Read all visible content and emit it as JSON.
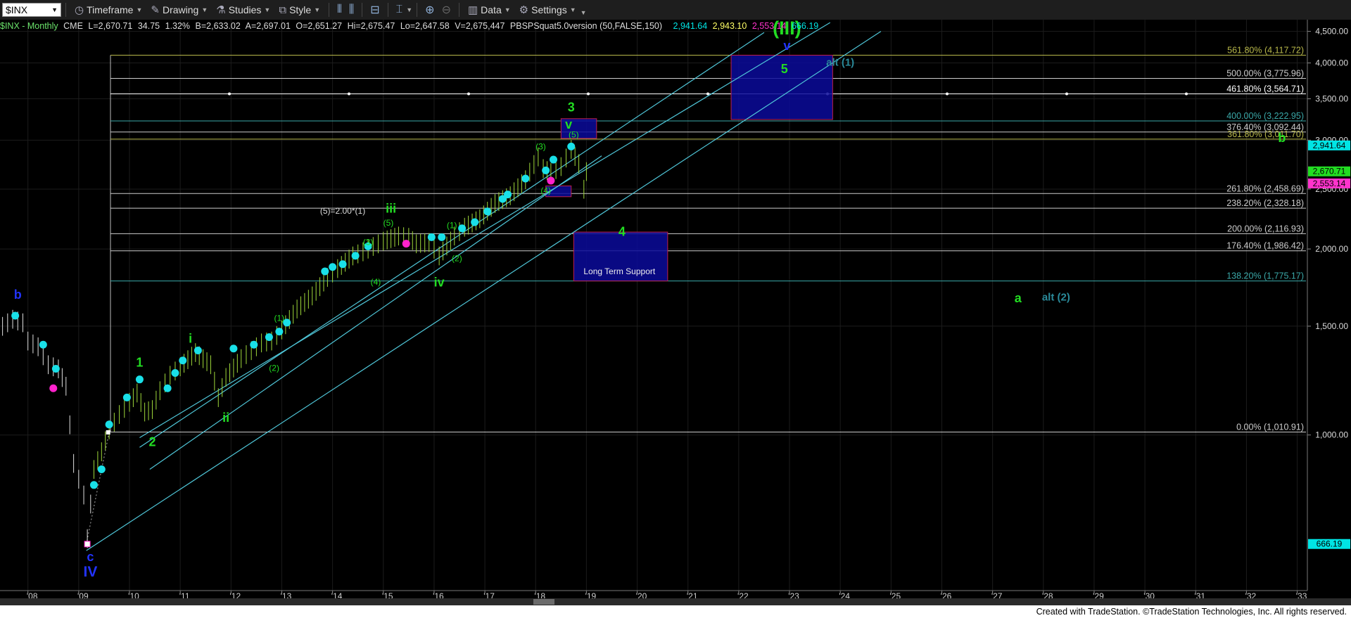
{
  "toolbar": {
    "symbol": "$INX",
    "items": [
      {
        "label": "Timeframe",
        "icon": "clock-icon"
      },
      {
        "label": "Drawing",
        "icon": "pencil-icon"
      },
      {
        "label": "Studies",
        "icon": "flask-icon"
      },
      {
        "label": "Style",
        "icon": "style-icon"
      },
      {
        "label": "Data",
        "icon": "bar-chart-icon"
      },
      {
        "label": "Settings",
        "icon": "gear-icon"
      }
    ]
  },
  "infobar": {
    "symbol_info": "$INX - Monthly",
    "exchange": "CME",
    "last": "L=2,670.71",
    "change": "34.75",
    "pct": "1.32%",
    "bid": "B=2,633.02",
    "ask": "A=2,697.01",
    "open": "O=2,651.27",
    "high": "Hi=2,675.47",
    "low": "Lo=2,647.58",
    "volume": "V=2,675,447",
    "study": "PBSPSquat5.0version (50,FALSE,150)",
    "study_vals": [
      {
        "text": "2,941.64",
        "color": "#00e5e5"
      },
      {
        "text": "2,943.10",
        "color": "#ffff66"
      },
      {
        "text": "2,553.14",
        "color": "#ff33cc"
      },
      {
        "text": "666.19",
        "color": "#00e5e5"
      }
    ]
  },
  "footer": "Created with TradeStation. ©TradeStation Technologies, Inc. All rights reserved.",
  "chart_data": {
    "type": "line",
    "title": "$INX - Monthly",
    "y_scale": "log",
    "ylim": [
      560,
      4700
    ],
    "xlim": [
      2007.45,
      2033.2
    ],
    "y_ticks": [
      {
        "value": 4500,
        "label": "4,500.00"
      },
      {
        "value": 4000,
        "label": "4,000.00"
      },
      {
        "value": 3500,
        "label": "3,500.00"
      },
      {
        "value": 3000,
        "label": "3,000.00"
      },
      {
        "value": 2500,
        "label": "2,500.00"
      },
      {
        "value": 2000,
        "label": "2,000.00"
      },
      {
        "value": 1500,
        "label": "1,500.00"
      },
      {
        "value": 1000,
        "label": "1,000.00"
      }
    ],
    "x_ticks": [
      "'08",
      "'09",
      "'10",
      "'11",
      "'12",
      "'13",
      "'14",
      "'15",
      "'16",
      "'17",
      "'18",
      "'19",
      "'20",
      "'21",
      "'22",
      "'23",
      "'24",
      "'25",
      "'26",
      "'27",
      "'28",
      "'29",
      "'30",
      "'31",
      "'32",
      "'33"
    ],
    "price_series": {
      "name": "$INX Monthly close",
      "x": [
        2007.5,
        2007.7,
        2007.9,
        2008.0,
        2008.2,
        2008.4,
        2008.6,
        2008.75,
        2008.9,
        2009.1,
        2009.17,
        2009.3,
        2009.45,
        2009.6,
        2009.8,
        2010.0,
        2010.15,
        2010.3,
        2010.45,
        2010.6,
        2010.8,
        2011.0,
        2011.3,
        2011.6,
        2011.75,
        2011.9,
        2012.2,
        2012.4,
        2012.6,
        2012.8,
        2013.0,
        2013.3,
        2013.6,
        2013.9,
        2014.1,
        2014.4,
        2014.6,
        2014.8,
        2015.0,
        2015.3,
        2015.5,
        2015.65,
        2015.9,
        2016.1,
        2016.4,
        2016.6,
        2016.9,
        2017.2,
        2017.5,
        2017.8,
        2018.05,
        2018.15,
        2018.3,
        2018.5,
        2018.7,
        2018.85,
        2018.95,
        2019.0
      ],
      "y": [
        1500,
        1540,
        1520,
        1420,
        1390,
        1300,
        1280,
        1200,
        900,
        800,
        680,
        880,
        940,
        1020,
        1080,
        1130,
        1170,
        1090,
        1100,
        1180,
        1250,
        1290,
        1360,
        1300,
        1150,
        1240,
        1330,
        1370,
        1410,
        1420,
        1480,
        1600,
        1680,
        1800,
        1860,
        1950,
        1980,
        2020,
        2060,
        2100,
        2090,
        2040,
        2050,
        1950,
        2100,
        2170,
        2240,
        2370,
        2440,
        2590,
        2820,
        2700,
        2660,
        2720,
        2900,
        2750,
        2500,
        2670
      ]
    },
    "cyan_dots": {
      "x": [
        2007.75,
        2008.3,
        2008.55,
        2009.3,
        2009.45,
        2009.6,
        2009.95,
        2010.2,
        2010.75,
        2010.9,
        2011.05,
        2011.35,
        2012.05,
        2012.45,
        2012.75,
        2012.95,
        2013.1,
        2013.85,
        2014.0,
        2014.2,
        2014.45,
        2014.7,
        2015.95,
        2016.15,
        2016.55,
        2016.8,
        2017.05,
        2017.35,
        2017.45,
        2017.8,
        2018.2,
        2018.35,
        2018.7
      ],
      "y": [
        1560,
        1400,
        1280,
        830,
        880,
        1040,
        1150,
        1230,
        1190,
        1260,
        1320,
        1370,
        1380,
        1400,
        1440,
        1470,
        1520,
        1840,
        1870,
        1890,
        1950,
        2020,
        2090,
        2090,
        2160,
        2210,
        2300,
        2410,
        2450,
        2600,
        2680,
        2790,
        2930
      ]
    },
    "magenta_dots": {
      "x": [
        2008.5,
        2015.45,
        2018.3
      ],
      "y": [
        1190,
        2040,
        2580
      ]
    },
    "fib_levels": [
      {
        "label": "561.80% (4,117.72)",
        "value": 4117.72,
        "color": "#b8b84a"
      },
      {
        "label": "500.00% (3,775.96)",
        "value": 3775.96,
        "color": "#cccccc"
      },
      {
        "label": "461.80% (3,564.71)",
        "value": 3564.71,
        "color": "#ffffff"
      },
      {
        "label": "400.00% (3,222.95)",
        "value": 3222.95,
        "color": "#3aa8a8"
      },
      {
        "label": "376.40% (3,092.44)",
        "value": 3092.44,
        "color": "#cccccc"
      },
      {
        "label": "361.80% (3,011.70)",
        "value": 3011.7,
        "color": "#b8b84a"
      },
      {
        "label": "261.80% (2,458.69)",
        "value": 2458.69,
        "color": "#cccccc"
      },
      {
        "label": "238.20% (2,328.18)",
        "value": 2328.18,
        "color": "#cccccc"
      },
      {
        "label": "200.00% (2,116.93)",
        "value": 2116.93,
        "color": "#cccccc"
      },
      {
        "label": "176.40% (1,986.42)",
        "value": 1986.42,
        "color": "#cccccc"
      },
      {
        "label": "138.20% (1,775.17)",
        "value": 1775.17,
        "color": "#3aa8a8"
      },
      {
        "label": "0.00% (1,010.91)",
        "value": 1010.91,
        "color": "#cccccc"
      }
    ],
    "price_tags": [
      {
        "value": 2941.64,
        "text": "2,941.64",
        "bg": "#00e5e5"
      },
      {
        "value": 2670.71,
        "text": "2,670.71",
        "bg": "#22dd22"
      },
      {
        "value": 2553.14,
        "text": "2,553.14",
        "bg": "#ff33cc"
      },
      {
        "value": 666.19,
        "text": "666.19",
        "bg": "#00e5e5"
      }
    ],
    "zones": [
      {
        "x0": 2021.85,
        "x1": 2023.85,
        "y0": 3240,
        "y1": 4117.72
      },
      {
        "x0": 2018.5,
        "x1": 2019.2,
        "y0": 3020,
        "y1": 3250
      },
      {
        "x0": 2018.2,
        "x1": 2018.7,
        "y0": 2430,
        "y1": 2530
      },
      {
        "x0": 2018.75,
        "x1": 2020.6,
        "y0": 1775.17,
        "y1": 2130
      }
    ],
    "channel_lines": [
      {
        "x0": 2009.15,
        "y0": 650,
        "x1": 2024.8,
        "y1": 4500
      },
      {
        "x0": 2010.2,
        "y0": 990,
        "x1": 2023.8,
        "y1": 4650
      },
      {
        "x0": 2010.4,
        "y0": 880,
        "x1": 2019.3,
        "y1": 2830
      },
      {
        "x0": 2010.2,
        "y0": 955,
        "x1": 2022.5,
        "y1": 4480
      }
    ],
    "annotations": [
      {
        "text": "b",
        "x": 2007.8,
        "y": 1660,
        "color": "#2233ff",
        "size": 18
      },
      {
        "text": "c",
        "x": 2009.23,
        "y": 625,
        "color": "#2233ff",
        "size": 18
      },
      {
        "text": "IV",
        "x": 2009.23,
        "y": 590,
        "color": "#2233ff",
        "size": 21
      },
      {
        "text": "1",
        "x": 2010.2,
        "y": 1290,
        "color": "#22dd22",
        "size": 18
      },
      {
        "text": "2",
        "x": 2010.45,
        "y": 960,
        "color": "#22dd22",
        "size": 18
      },
      {
        "text": "i",
        "x": 2011.2,
        "y": 1410,
        "color": "#22dd22",
        "size": 18
      },
      {
        "text": "ii",
        "x": 2011.9,
        "y": 1050,
        "color": "#22dd22",
        "size": 18
      },
      {
        "text": "(1)",
        "x": 2012.95,
        "y": 1530,
        "color": "#22dd22",
        "size": 12
      },
      {
        "text": "(2)",
        "x": 2012.85,
        "y": 1270,
        "color": "#22dd22",
        "size": 12
      },
      {
        "text": "(3)",
        "x": 2014.7,
        "y": 2030,
        "color": "#22dd22",
        "size": 12
      },
      {
        "text": "(4)",
        "x": 2014.85,
        "y": 1750,
        "color": "#22dd22",
        "size": 12
      },
      {
        "text": "(5)",
        "x": 2015.1,
        "y": 2180,
        "color": "#22dd22",
        "size": 12
      },
      {
        "text": "(5)=2.00*(1)",
        "x": 2014.2,
        "y": 2280,
        "color": "#dddddd",
        "size": 12
      },
      {
        "text": "iii",
        "x": 2015.15,
        "y": 2290,
        "color": "#22dd22",
        "size": 18
      },
      {
        "text": "iv",
        "x": 2016.1,
        "y": 1740,
        "color": "#22dd22",
        "size": 18
      },
      {
        "text": "(1)",
        "x": 2016.35,
        "y": 2160,
        "color": "#22dd22",
        "size": 12
      },
      {
        "text": "(2)",
        "x": 2016.45,
        "y": 1910,
        "color": "#22dd22",
        "size": 12
      },
      {
        "text": "(3)",
        "x": 2018.1,
        "y": 2900,
        "color": "#22dd22",
        "size": 12
      },
      {
        "text": "(4)",
        "x": 2018.2,
        "y": 2460,
        "color": "#22dd22",
        "size": 12
      },
      {
        "text": "(5)",
        "x": 2018.75,
        "y": 3030,
        "color": "#22dd22",
        "size": 12
      },
      {
        "text": "v",
        "x": 2018.65,
        "y": 3130,
        "color": "#22dd22",
        "size": 18
      },
      {
        "text": "3",
        "x": 2018.7,
        "y": 3340,
        "color": "#22dd22",
        "size": 18
      },
      {
        "text": "4",
        "x": 2019.7,
        "y": 2100,
        "color": "#22dd22",
        "size": 18
      },
      {
        "text": "Long Term Support",
        "x": 2019.65,
        "y": 1820,
        "color": "#eeeeee",
        "size": 12
      },
      {
        "text": "(III)",
        "x": 2022.95,
        "y": 4450,
        "color": "#22dd22",
        "size": 27
      },
      {
        "text": "v",
        "x": 2022.95,
        "y": 4200,
        "color": "#2233ff",
        "size": 18
      },
      {
        "text": "5",
        "x": 2022.9,
        "y": 3850,
        "color": "#22dd22",
        "size": 18
      },
      {
        "text": "alt (1)",
        "x": 2024.0,
        "y": 3960,
        "color": "#2a8a9a",
        "size": 15
      },
      {
        "text": "b",
        "x": 2032.7,
        "y": 2980,
        "color": "#22dd22",
        "size": 18
      },
      {
        "text": "a",
        "x": 2027.5,
        "y": 1640,
        "color": "#22dd22",
        "size": 18
      },
      {
        "text": "alt (2)",
        "x": 2028.25,
        "y": 1650,
        "color": "#2a8a9a",
        "size": 15
      }
    ]
  }
}
